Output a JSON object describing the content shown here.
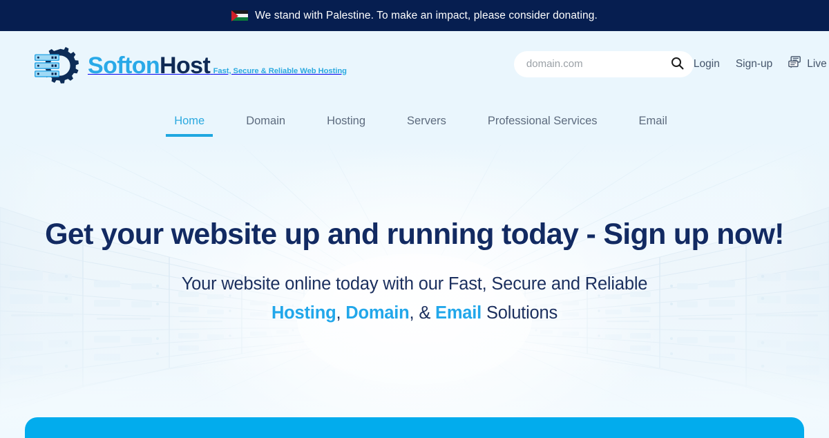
{
  "banner": {
    "flag_icon": "palestine-flag-icon",
    "text": "We stand with Palestine. To make an impact, please consider donating."
  },
  "header": {
    "logo": {
      "mark_icon": "gear-server-logo-icon",
      "name_part1": "Softon",
      "name_part2": "Host",
      "tagline": "Fast, Secure & Reliable Web Hosting"
    },
    "search": {
      "placeholder": "domain.com",
      "value": "",
      "icon": "search-icon"
    },
    "account": {
      "login": "Login",
      "signup": "Sign-up",
      "live_chat": "Live Chat",
      "live_chat_icon": "chat-bubbles-icon"
    },
    "nav": [
      {
        "label": "Home",
        "active": true
      },
      {
        "label": "Domain",
        "active": false
      },
      {
        "label": "Hosting",
        "active": false
      },
      {
        "label": "Servers",
        "active": false
      },
      {
        "label": "Professional Services",
        "active": false
      },
      {
        "label": "Email",
        "active": false
      }
    ]
  },
  "hero": {
    "title": "Get your website up and running today - Sign up now!",
    "sub_line1": "Your website online today with our Fast, Secure and Reliable",
    "sub_hl1": "Hosting",
    "sub_sep1": ", ",
    "sub_hl2": "Domain",
    "sub_sep2": ", & ",
    "sub_hl3": "Email",
    "sub_tail": " Solutions"
  },
  "colors": {
    "banner_bg": "#061e50",
    "header_bg": "#eaf6fd",
    "accent_cyan": "#02aced",
    "nav_active": "#2ba9e0",
    "heading_navy": "#122a62",
    "bottom_panel": "#02aced"
  }
}
